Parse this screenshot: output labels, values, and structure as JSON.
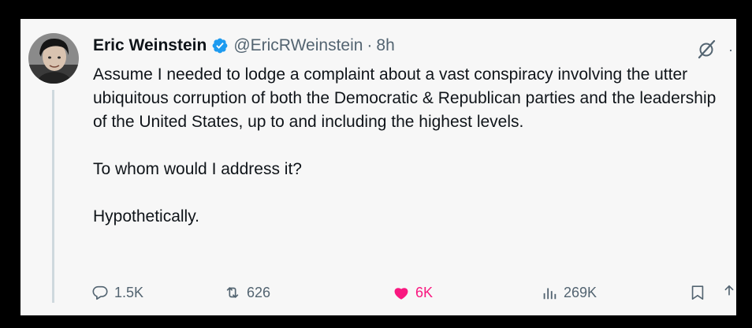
{
  "tweet": {
    "author_name": "Eric Weinstein",
    "handle": "@EricRWeinstein",
    "separator": "·",
    "time": "8h",
    "paragraphs": [
      "Assume I needed to lodge a complaint about a vast conspiracy involving the utter ubiquitous corruption of both the Democratic & Republican parties and the leadership of the United States, up to and including the highest levels.",
      "To whom would I address it?",
      "Hypothetically."
    ]
  },
  "actions": {
    "replies": "1.5K",
    "reposts": "626",
    "likes": "6K",
    "views": "269K"
  },
  "icons": {
    "verified": "verified-badge-icon",
    "grok": "grok-icon",
    "reply": "reply-icon",
    "repost": "repost-icon",
    "like": "heart-icon",
    "views": "views-chart-icon",
    "bookmark": "bookmark-icon"
  },
  "colors": {
    "verified_blue": "#1d9bf0",
    "like_pink": "#f91880",
    "secondary_text": "#536471",
    "background": "#f7f7f7",
    "frame": "#000000"
  }
}
